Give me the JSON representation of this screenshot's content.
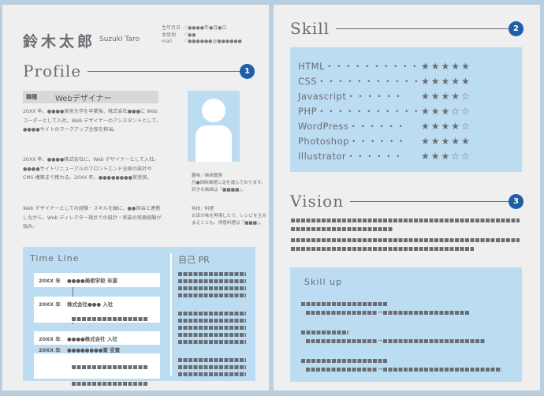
{
  "header": {
    "name": "鈴木太郎",
    "name_en": "Suzuki Taro",
    "meta": [
      {
        "key": "生年月日",
        "value": "／●●●●年●月●日"
      },
      {
        "key": "本居地",
        "value": "／●●"
      },
      {
        "key": "mail",
        "value": "／●●●●●●@●●●●●●"
      }
    ]
  },
  "profile": {
    "title": "Profile",
    "badge": "1",
    "job_key": "職種",
    "job_value": "Webデザイナー",
    "paragraphs": [
      "20XX 年、●●●●美術大学を卒業後、株式会社●●●に Web コーダーとして入社。Web デザイナーのアシスタントとして、●●●●サイトのマークアップ全般を担当。",
      "20XX 年、●●●●株式会社に、Web デザイナーとして入社。●●●●サイトリニューアルのフロントエンド全般の設計や CMS 構築まで携わる。20XX 年、●●●●●●●●賞受賞。",
      "Web デザイナーとしての経験・スキルを軸に、●●担当と連携しながら、Web ディレクター視点での設計・実装の実務経験が強み。"
    ],
    "hobby_title": "趣味／映画鑑賞",
    "hobby_text": "月●回映画館に足を運んでおります。好きな映画は『■■■■』。",
    "special_title": "特技／料理",
    "special_text": "お店の味を再現したり、レシピを主みまえことも。得意料理は『■■■』。"
  },
  "timeline": {
    "title": "Time Line",
    "cards": [
      {
        "rows": [
          {
            "year": "20XX 年",
            "text": "●●●●美術学校 卒業",
            "hl": false
          }
        ]
      },
      {
        "rows": [
          {
            "year": "20XX 年",
            "text": "株式会社●●● 入社",
            "hl": false
          }
        ]
      },
      {
        "rows": [
          {
            "year": "20XX 年",
            "text": "●●●●株式会社 入社",
            "hl": false
          },
          {
            "year": "20XX 年",
            "text": "●●●●●●●●賞 受賞",
            "hl": true
          }
        ]
      }
    ]
  },
  "pr": {
    "title": "自己 PR"
  },
  "skill": {
    "title": "Skill",
    "badge": "2",
    "items": [
      {
        "name": "HTML・・・・・・・・・・・",
        "stars": "★★★★★"
      },
      {
        "name": "CSS・・・・・・・・・・・・",
        "stars": "★★★★★"
      },
      {
        "name": "Javascript・・・・・・",
        "stars": "★★★★☆"
      },
      {
        "name": "PHP・・・・・・・・・・・",
        "stars": "★★★☆☆"
      },
      {
        "name": "WordPress・・・・・・",
        "stars": "★★★★☆"
      },
      {
        "name": "Photoshop・・・・・・",
        "stars": "★★★★★"
      },
      {
        "name": "Illustrator・・・・・・",
        "stars": "★★★☆☆"
      }
    ]
  },
  "vision": {
    "title": "Vision",
    "badge": "3"
  },
  "skillup": {
    "title": "Skill up",
    "arrow": "→"
  }
}
